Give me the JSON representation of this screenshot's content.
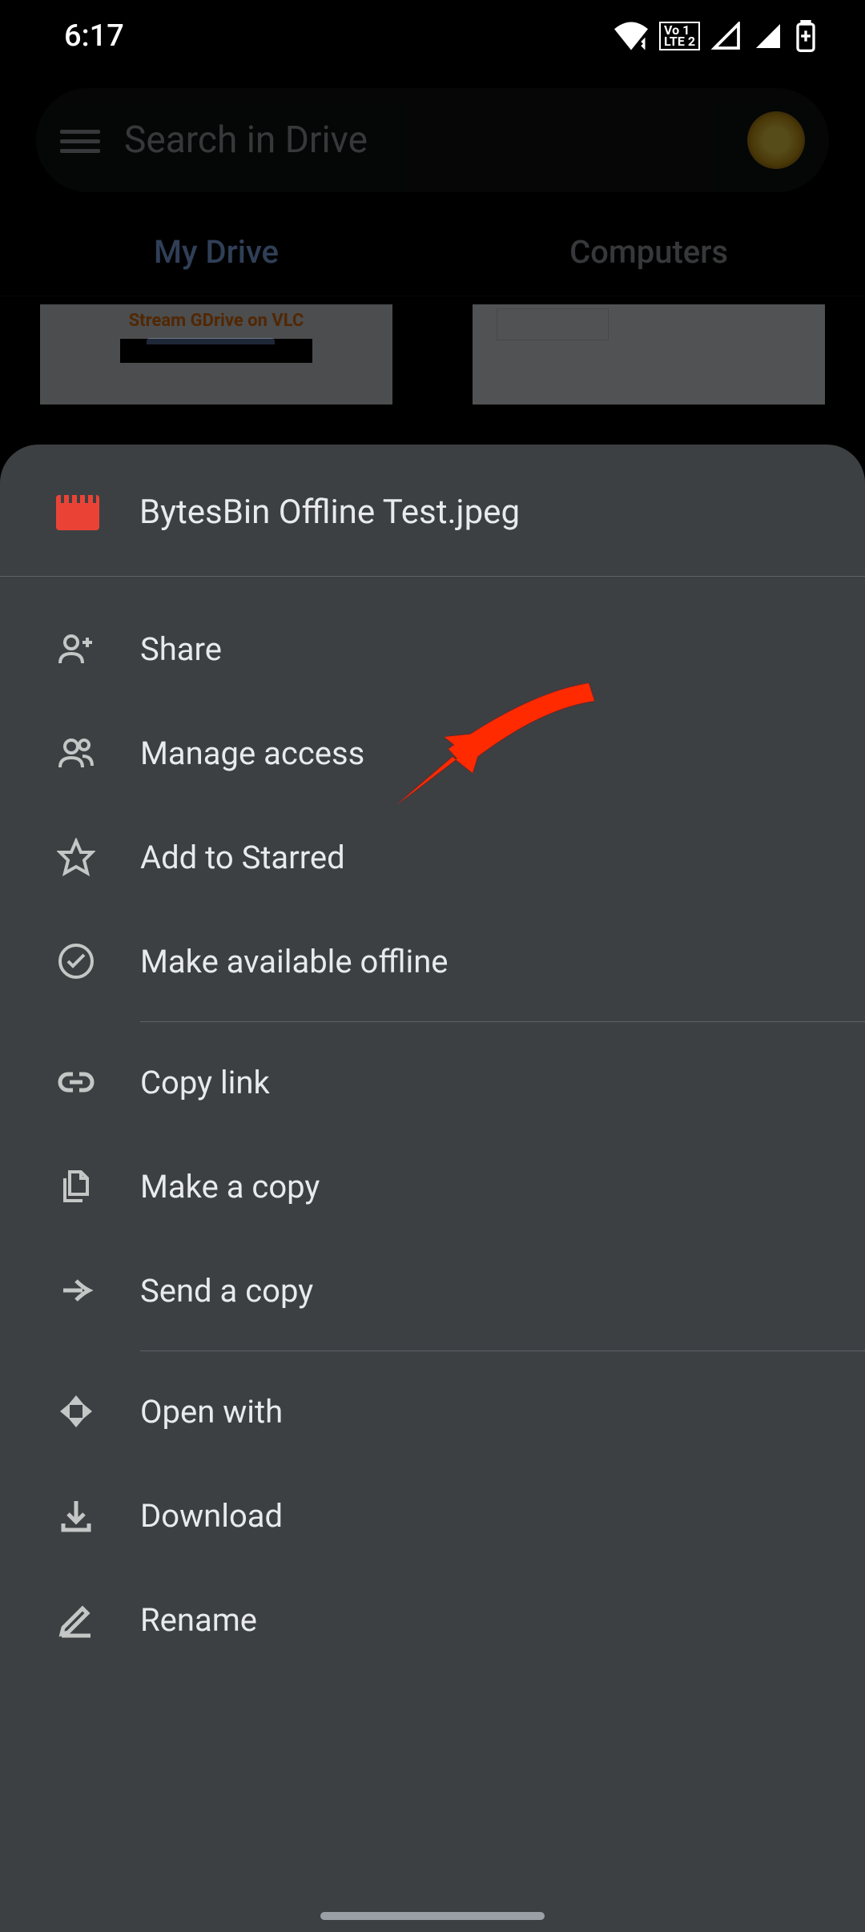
{
  "statusBar": {
    "time": "6:17",
    "lteBadge": "Vo 1\nLTE 2"
  },
  "search": {
    "placeholder": "Search in Drive"
  },
  "tabs": {
    "myDrive": "My Drive",
    "computers": "Computers"
  },
  "thumbnails": {
    "item0_text": "Stream GDrive on VLC"
  },
  "bottomSheet": {
    "fileName": "BytesBin Offline Test.jpeg",
    "menu": {
      "share": "Share",
      "manageAccess": "Manage access",
      "addToStarred": "Add to Starred",
      "makeOffline": "Make available offline",
      "copyLink": "Copy link",
      "makeCopy": "Make a copy",
      "sendCopy": "Send a copy",
      "openWith": "Open with",
      "download": "Download",
      "rename": "Rename"
    }
  },
  "annotation": {
    "target": "manage-access",
    "type": "arrow",
    "color": "#ff2a00"
  }
}
